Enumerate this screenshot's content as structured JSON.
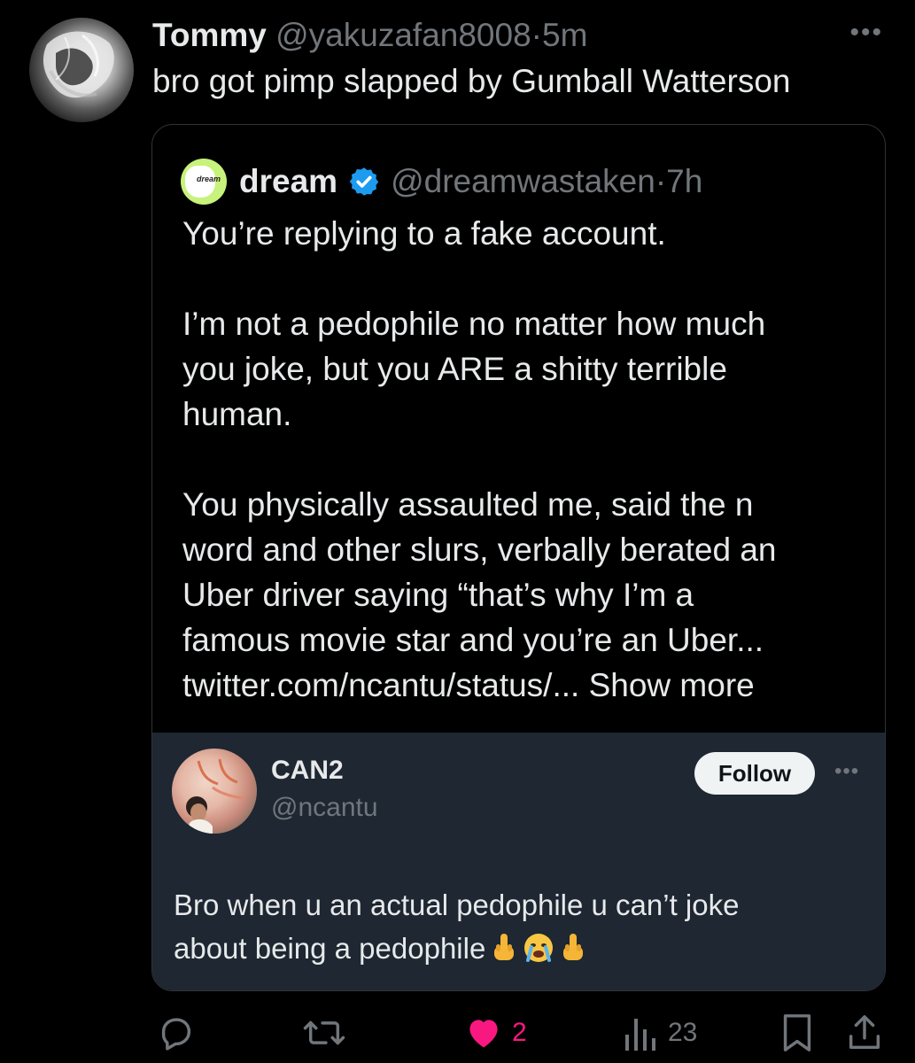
{
  "tweet": {
    "author_name": "Tommy",
    "author_handle": "@yakuzafan8008",
    "separator": "·",
    "time": "5m",
    "more_icon": "more-horizontal-icon",
    "text": "bro got pimp slapped by Gumball Watterson"
  },
  "quote": {
    "name": "dream",
    "avatar_label": "dream",
    "verified_icon": "verified-badge-icon",
    "handle": "@dreamwastaken",
    "separator": "·",
    "time": "7h",
    "paragraph_1": "You’re replying to a fake account.",
    "paragraph_2_lines": [
      "I’m not a pedophile no matter how much",
      "you joke, but you ARE a shitty terrible",
      "human."
    ],
    "paragraph_3_lines": [
      "You physically assaulted me, said the n",
      "word and other slurs, verbally berated an",
      "Uber driver saying “that’s why I’m a",
      "famous movie star and you’re an Uber..."
    ],
    "link_text": "twitter.com/ncantu/status/...",
    "show_more": "Show more",
    "embedded": {
      "name": "CAN2",
      "handle": "@ncantu",
      "follow_label": "Follow",
      "text_line_1": "Bro when u an actual pedophile u can’t joke",
      "text_line_2": "about being a pedophile"
    }
  },
  "actions": {
    "reply_count": "",
    "retweet_count": "",
    "like_count": "2",
    "views_count": "23",
    "icons": [
      "reply-icon",
      "retweet-icon",
      "heart-icon",
      "views-icon",
      "bookmark-icon",
      "share-icon"
    ]
  },
  "colors": {
    "background": "#000000",
    "text": "#e7e9ea",
    "muted": "#71767b",
    "verified": "#1d9bf0",
    "like": "#f91880",
    "embedded_bg": "#1e2732",
    "border": "#2f3336"
  }
}
